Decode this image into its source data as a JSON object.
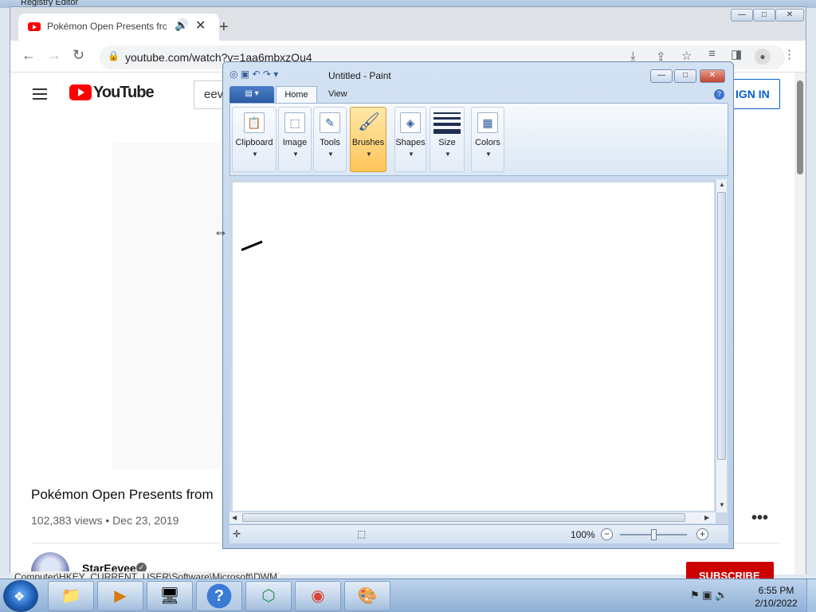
{
  "registry": {
    "title": "Registry Editor"
  },
  "chrome": {
    "tab_title": "Pokémon Open Presents from",
    "tab_audio": "🔊",
    "tab_close": "✕",
    "new_tab": "+",
    "url": "youtube.com/watch?v=1aa6mbxzOu4",
    "win_min": "—",
    "win_max": "□",
    "win_close": "✕"
  },
  "youtube": {
    "logo_text": "YouTube",
    "search_value": "eev",
    "signin_label": "IGN IN",
    "video_title": "Pokémon Open Presents from",
    "video_meta": "102,383 views • Dec 23, 2019",
    "more": "•••",
    "channel_name": "StarEevee",
    "verified": "✓",
    "subscribe": "SUBSCRIBE"
  },
  "status_url": "Computer\\HKEY_CURRENT_USER\\Software\\Microsoft\\DWM",
  "paint": {
    "title": "Untitled - Paint",
    "qa_icons": "◎ ▣ ↶ ↷ ▾",
    "file_tab": "▤ ▾",
    "tabs": {
      "home": "Home",
      "view": "View"
    },
    "help": "?",
    "groups": [
      {
        "key": "clipboard",
        "label": "Clipboard",
        "icon": "📋"
      },
      {
        "key": "image",
        "label": "Image",
        "icon": "⬚"
      },
      {
        "key": "tools",
        "label": "Tools",
        "icon": "✎"
      },
      {
        "key": "brushes",
        "label": "Brushes",
        "icon": "🖌"
      },
      {
        "key": "shapes",
        "label": "Shapes",
        "icon": "◈"
      },
      {
        "key": "size",
        "label": "Size",
        "icon": ""
      },
      {
        "key": "colors",
        "label": "Colors",
        "icon": "▦"
      }
    ],
    "zoom": "100%",
    "zoom_minus": "−",
    "zoom_plus": "+",
    "zoom_level": 0.5,
    "status_move_icon": "✛",
    "status_select_icon": "⬚"
  },
  "taskbar": {
    "start_icon": "❖",
    "buttons": [
      {
        "name": "explorer",
        "icon": "📁"
      },
      {
        "name": "media-player",
        "icon": "▶"
      },
      {
        "name": "control-panel",
        "icon": "🖥"
      },
      {
        "name": "help",
        "icon": "?"
      },
      {
        "name": "registry",
        "icon": "⬡"
      },
      {
        "name": "chrome",
        "icon": "◉"
      },
      {
        "name": "paint",
        "icon": "🎨"
      }
    ],
    "tray": "⚑ ▣ 🔊",
    "time": "6:55 PM",
    "date": "2/10/2022"
  },
  "colors": {
    "youtube_red": "#ff0000",
    "link_blue": "#065fd4",
    "subscribe": "#cc0000"
  }
}
